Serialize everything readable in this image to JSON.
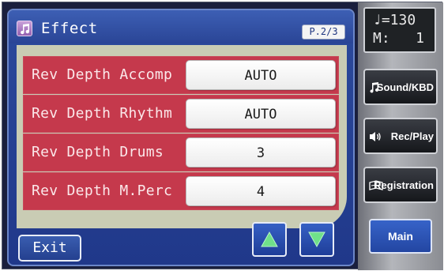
{
  "header": {
    "title": "Effect",
    "page": "P.2/3",
    "icon": "music-note-icon"
  },
  "rows": [
    {
      "label": "Rev Depth Accomp",
      "value": "AUTO"
    },
    {
      "label": "Rev Depth Rhythm",
      "value": "AUTO"
    },
    {
      "label": "Rev Depth Drums",
      "value": "3"
    },
    {
      "label": "Rev Depth M.Perc",
      "value": "4"
    }
  ],
  "footer": {
    "exit_label": "Exit",
    "up_icon": "arrow-up-icon",
    "down_icon": "arrow-down-icon"
  },
  "status": {
    "tempo": "=130",
    "measure": "M:   1"
  },
  "side_buttons": {
    "sound": "Sound/KBD",
    "rec": "Rec/Play",
    "registration": "Registration",
    "main": "Main"
  },
  "colors": {
    "row_red": "#c5394c",
    "panel_blue": "#2a4596",
    "arrow_green": "#6fe08a",
    "content_beige": "#c9ccb4"
  }
}
